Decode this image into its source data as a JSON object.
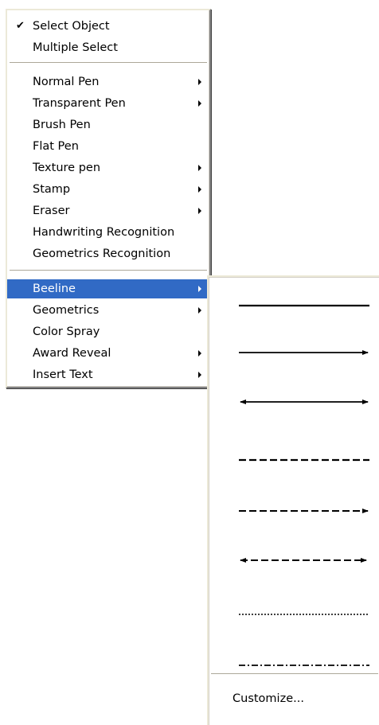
{
  "menu": {
    "group1": [
      {
        "label": "Select Object",
        "checked": true
      },
      {
        "label": "Multiple Select"
      }
    ],
    "group2": [
      {
        "label": "Normal Pen",
        "submenu": true
      },
      {
        "label": "Transparent Pen",
        "submenu": true
      },
      {
        "label": "Brush Pen"
      },
      {
        "label": "Flat Pen"
      },
      {
        "label": "Texture pen",
        "submenu": true
      },
      {
        "label": "Stamp",
        "submenu": true
      },
      {
        "label": "Eraser",
        "submenu": true
      },
      {
        "label": "Handwriting Recognition"
      },
      {
        "label": "Geometrics Recognition"
      }
    ],
    "group3": [
      {
        "label": "Beeline",
        "submenu": true,
        "highlighted": true
      },
      {
        "label": "Geometrics",
        "submenu": true
      },
      {
        "label": "Color Spray"
      },
      {
        "label": "Award Reveal",
        "submenu": true
      },
      {
        "label": "Insert Text",
        "submenu": true
      }
    ]
  },
  "submenu": {
    "lines": [
      {
        "style": "solid-thick"
      },
      {
        "style": "solid-arrow-end"
      },
      {
        "style": "solid-arrow-both"
      },
      {
        "style": "dashed"
      },
      {
        "style": "dashed-arrow-end"
      },
      {
        "style": "dashed-arrow-both"
      },
      {
        "style": "dotted"
      },
      {
        "style": "dash-dot"
      }
    ],
    "customize_label": "Customize..."
  },
  "colors": {
    "highlight": "#316ac5",
    "highlight_text": "#ffffff",
    "separator": "#aca899"
  },
  "icons": {
    "check": "check-icon",
    "submenu_arrow": "chevron-right-icon"
  }
}
